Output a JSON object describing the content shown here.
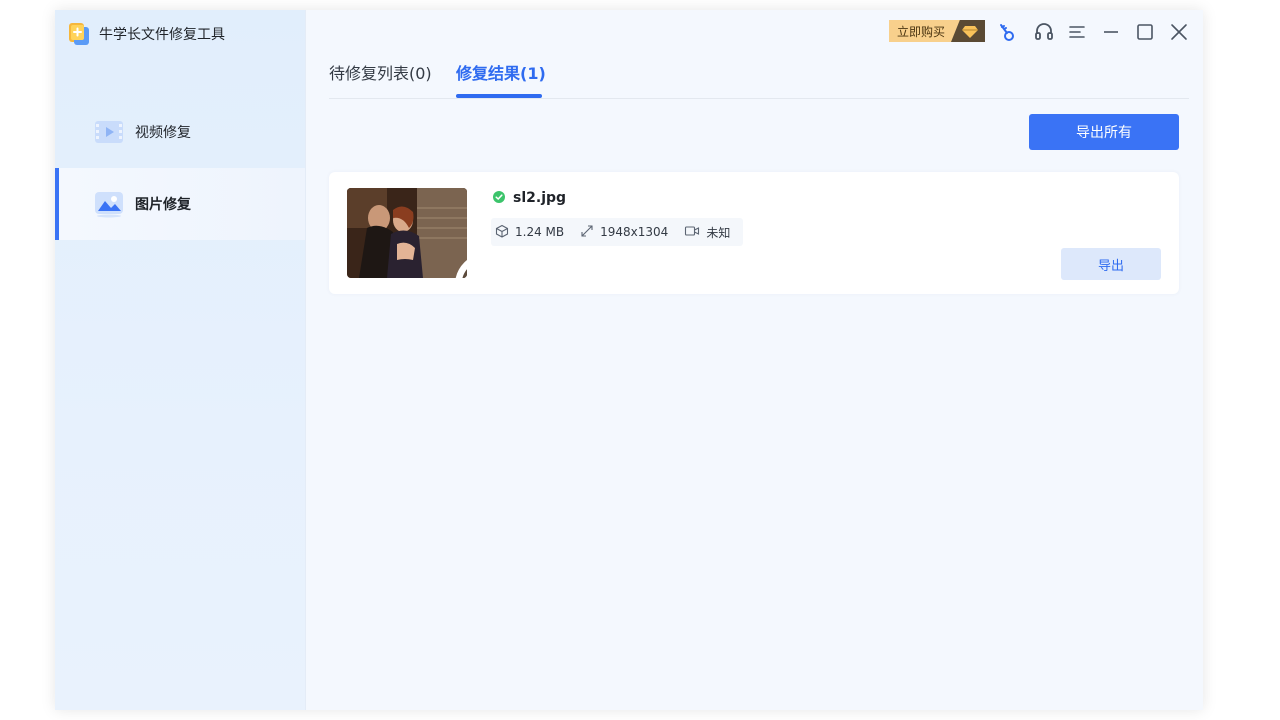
{
  "app": {
    "title": "牛学长文件修复工具"
  },
  "sidebar": {
    "items": [
      {
        "label": "视频修复",
        "active": false,
        "icon": "video-icon"
      },
      {
        "label": "图片修复",
        "active": true,
        "icon": "image-icon"
      }
    ]
  },
  "topbar": {
    "buy_label": "立即购买",
    "icons": [
      "diamond-icon",
      "key-icon",
      "headset-icon",
      "menu-icon",
      "minimize-icon",
      "maximize-icon",
      "close-icon"
    ]
  },
  "tabs": [
    {
      "label": "待修复列表(0)",
      "active": false
    },
    {
      "label": "修复结果(1)",
      "active": true
    }
  ],
  "actions": {
    "export_all_label": "导出所有"
  },
  "results": [
    {
      "file_name": "sl2.jpg",
      "status": "success",
      "size": "1.24 MB",
      "resolution": "1948x1304",
      "device": "未知",
      "export_label": "导出"
    }
  ],
  "colors": {
    "accent": "#3a73f5",
    "success": "#3cc46b",
    "buy_bg": "#f8d08c",
    "export_bg": "#dde8fb"
  }
}
